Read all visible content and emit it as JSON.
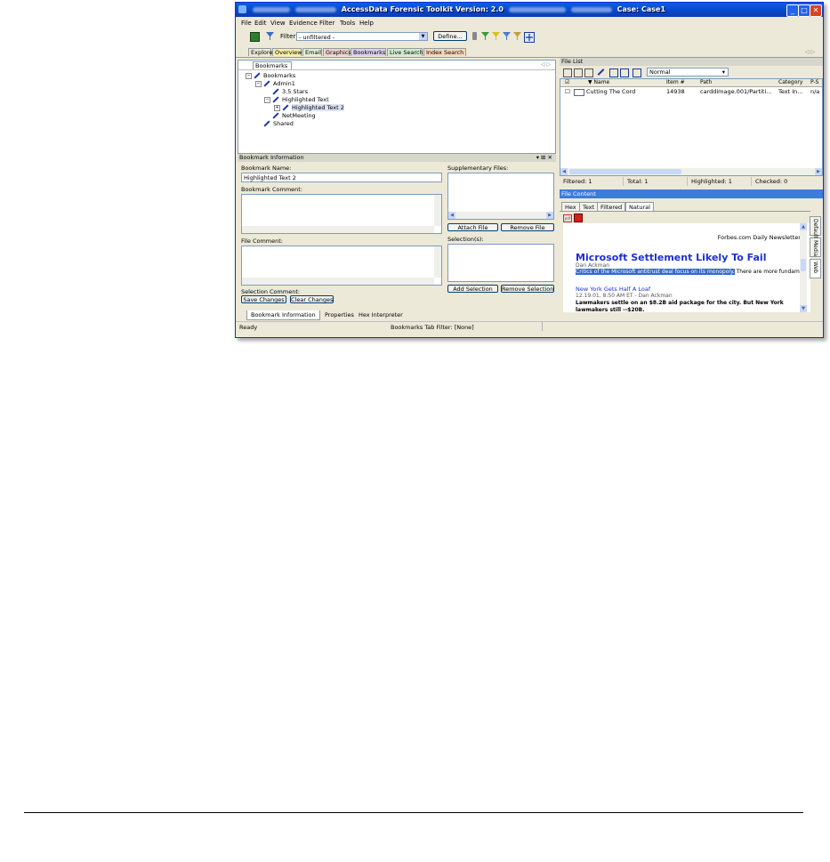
{
  "window": {
    "title_prefix": "AccessData Forensic Toolkit Version: 2.0",
    "title_case": "Case: Case1",
    "min": "_",
    "max": "□",
    "close": "✕"
  },
  "menu": [
    "File",
    "Edit",
    "View",
    "Evidence",
    "Filter",
    "Tools",
    "Help"
  ],
  "toolbar": {
    "filter_label": "Filter:",
    "filter_value": "- unfiltered -",
    "define_label": "Define..."
  },
  "main_tabs": [
    {
      "label": "Explore",
      "color": "#eef2e0"
    },
    {
      "label": "Overview",
      "color": "#f8f0a0"
    },
    {
      "label": "Email",
      "color": "#e4f0d6"
    },
    {
      "label": "Graphics",
      "color": "#f2d2d2"
    },
    {
      "label": "Bookmarks",
      "color": "#dcd0f0"
    },
    {
      "label": "Live Search",
      "color": "#d0ecd0"
    },
    {
      "label": "Index Search",
      "color": "#f8d8b8"
    }
  ],
  "bookmarks_pane": {
    "tab": "Bookmarks",
    "tree": {
      "root": "Bookmarks",
      "admin": "Admin1",
      "stars": "3.5 Stars",
      "highlighted": "Highlighted Text",
      "highlighted2": "Highlighted Text 2",
      "netmeeting": "NetMeeting",
      "shared": "Shared"
    }
  },
  "bookmark_info": {
    "header": "Bookmark Information",
    "name_label": "Bookmark Name:",
    "name_value": "Highlighted Text 2",
    "comment_label": "Bookmark Comment:",
    "file_comment_label": "File Comment:",
    "selection_comment_label": "Selection Comment:",
    "supp_files_label": "Supplementary Files:",
    "attach_label": "Attach File",
    "remove_file_label": "Remove File",
    "selections_label": "Selection(s):",
    "add_selection_label": "Add Selection",
    "remove_selection_label": "Remove Selection",
    "save_label": "Save Changes",
    "clear_label": "Clear Changes"
  },
  "bottom_tabs": [
    "Bookmark Information",
    "Properties",
    "Hex Interpreter"
  ],
  "status": {
    "ready": "Ready",
    "filter": "Bookmarks Tab Filter: [None]"
  },
  "file_list": {
    "header": "File List",
    "view_mode": "Normal",
    "columns": [
      "Name",
      "Item #",
      "Path",
      "Category",
      "P-S"
    ],
    "rows": [
      {
        "name": "Cutting The Cord",
        "item": "14938",
        "path": "carddimage.001/Partiti...",
        "category": "Text In...",
        "ps": "n/a"
      }
    ],
    "counts": {
      "filtered": "Filtered: 1",
      "total": "Total: 1",
      "highlighted": "Highlighted: 1",
      "checked": "Checked: 0"
    }
  },
  "file_content": {
    "header": "File Content",
    "tabs": [
      "Hex",
      "Text",
      "Filtered",
      "Natural"
    ],
    "side_tabs": [
      "Default",
      "Media",
      "Web"
    ],
    "doc": {
      "forbes": "Forbes.com Daily Newsletter D",
      "headline": "Microsoft Settlement Likely To Fail",
      "byline": "Dan Ackman",
      "lead_selected": "Critics of the Microsoft antitrust deal focus on its monopoly.",
      "lead_rest": " There are more fundame",
      "sub": "New York Gets Half A Loaf",
      "subdate": "12.19.01, 8:50 AM ET - Dan Ackman",
      "para": "Lawmakers settle on an $8.2B aid package for the city. But New York lawmakers still --$20B."
    }
  }
}
